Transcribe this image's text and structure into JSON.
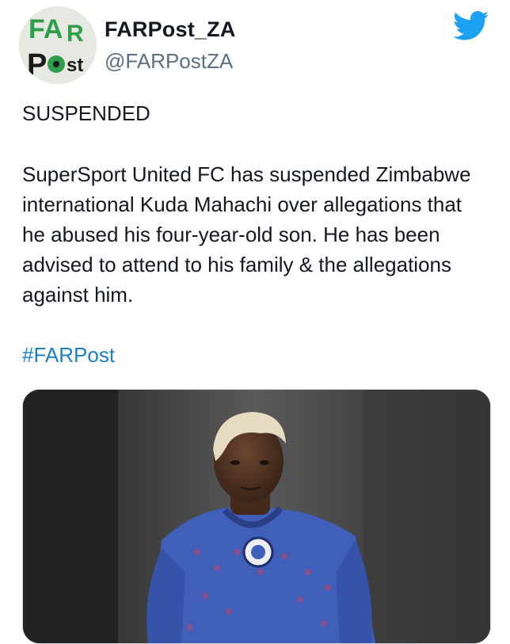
{
  "account": {
    "display_name": "FARPost_ZA",
    "handle": "@FARPostZA",
    "avatar_logo_text_top": "FAR",
    "avatar_logo_text_bottom": "Post"
  },
  "tweet": {
    "headline": "SUSPENDED",
    "body": "SuperSport United FC has suspended Zimbabwe international Kuda Mahachi over allegations that he abused his four-year-old son. He has been advised to attend to his family & the allegations against him.",
    "hashtag": "#FARPost"
  },
  "icons": {
    "brand": "twitter-bird-icon"
  },
  "colors": {
    "twitter_blue": "#1DA1F2",
    "hashtag_link": "#1b7fc4",
    "handle_gray": "#5b7083",
    "logo_green": "#2e9e4a",
    "jersey_blue": "#3f5fb8"
  }
}
